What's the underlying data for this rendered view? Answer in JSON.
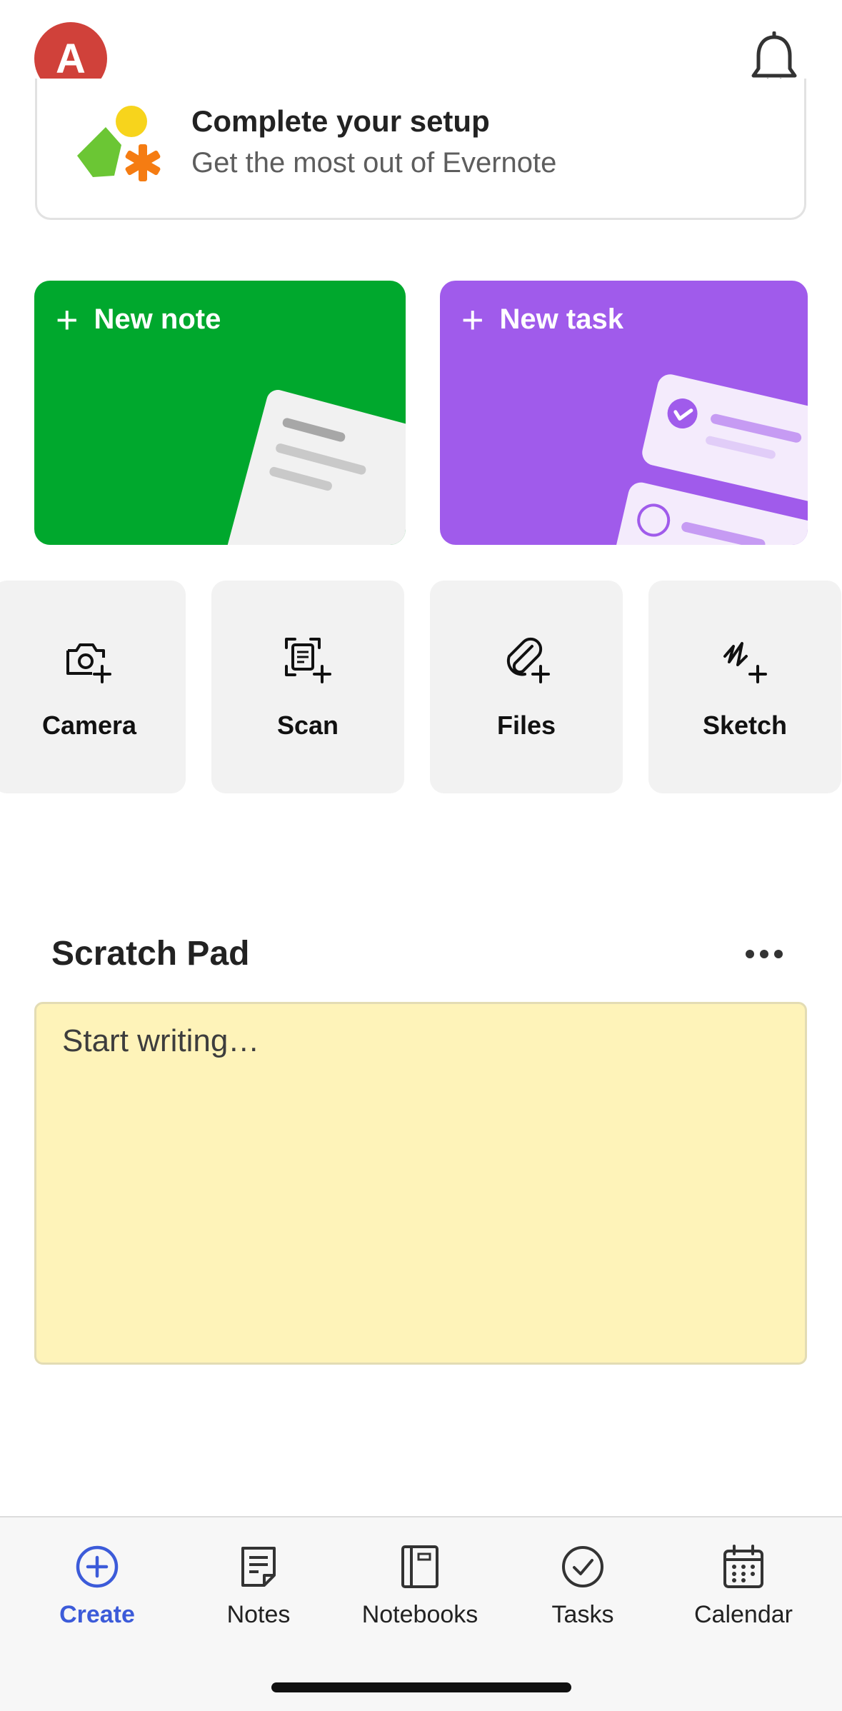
{
  "header": {
    "avatar_initial": "A",
    "avatar_color": "#d0413a",
    "notification_icon": "bell-icon"
  },
  "setup": {
    "title": "Complete your setup",
    "subtitle": "Get the most out of Evernote",
    "icon": "setup-shapes-icon"
  },
  "actions": {
    "new_note": {
      "label": "New note",
      "color": "#00a82d"
    },
    "new_task": {
      "label": "New task",
      "color": "#a05beb"
    }
  },
  "quick": [
    {
      "label": "Camera",
      "icon": "camera-plus-icon"
    },
    {
      "label": "Scan",
      "icon": "scan-plus-icon"
    },
    {
      "label": "Files",
      "icon": "paperclip-plus-icon"
    },
    {
      "label": "Sketch",
      "icon": "sketch-plus-icon"
    }
  ],
  "scratch": {
    "title": "Scratch Pad",
    "placeholder": "Start writing…",
    "more_icon": "more-horizontal-icon",
    "background": "#fef3b9"
  },
  "nav": [
    {
      "label": "Create",
      "icon": "plus-circle-icon",
      "active": true
    },
    {
      "label": "Notes",
      "icon": "note-icon",
      "active": false
    },
    {
      "label": "Notebooks",
      "icon": "notebook-icon",
      "active": false
    },
    {
      "label": "Tasks",
      "icon": "check-circle-icon",
      "active": false
    },
    {
      "label": "Calendar",
      "icon": "calendar-icon",
      "active": false
    }
  ],
  "accent_color": "#3c5bd9"
}
